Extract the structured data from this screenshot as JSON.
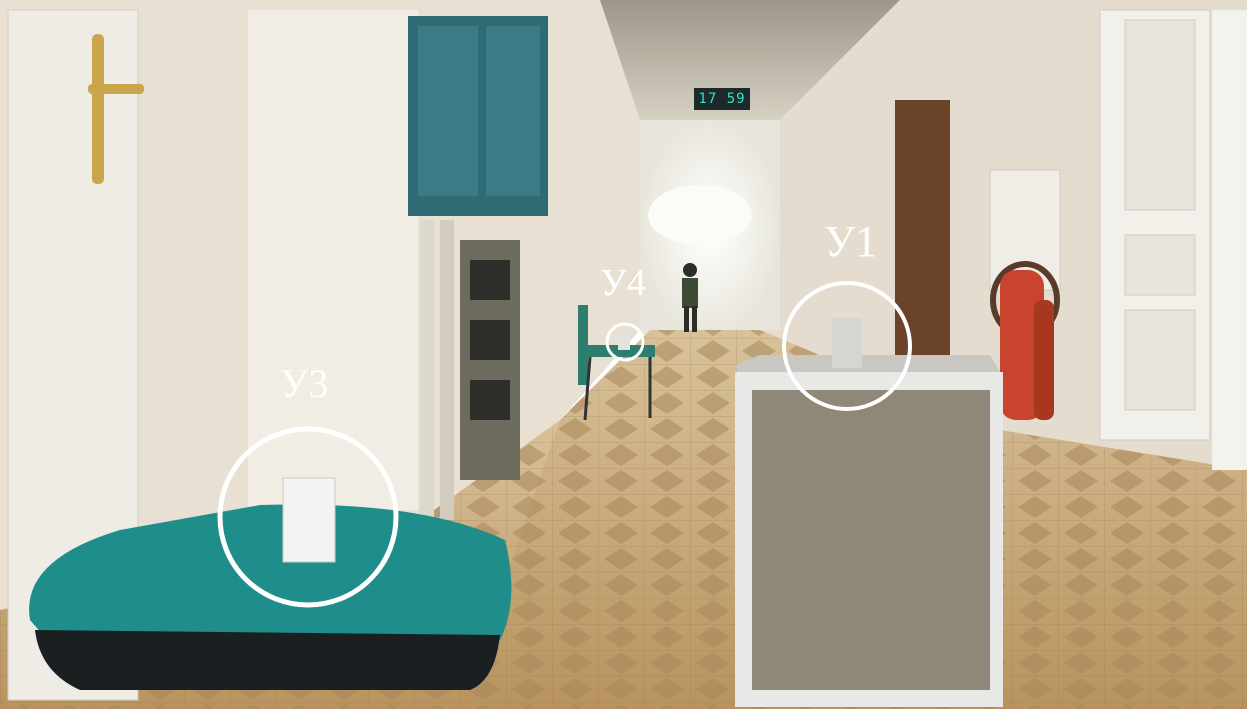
{
  "scene": {
    "description_labels": {
      "y1": "У1",
      "y3": "У3",
      "y4": "У4"
    },
    "clock_display": "17 59"
  },
  "colors": {
    "floor": "#c9a877",
    "wall": "#e6dfd2",
    "cabinet": "#2f6b75",
    "stool_seat": "#1f8e8a",
    "box": "#8f8878",
    "extinguisher": "#c8442f",
    "circle": "#ffffff"
  }
}
